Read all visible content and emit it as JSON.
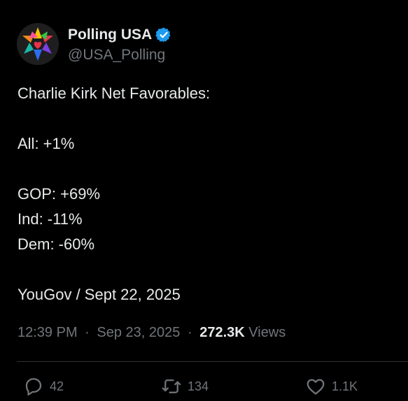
{
  "account": {
    "display_name": "Polling USA",
    "handle": "@USA_Polling",
    "verified": true,
    "verified_color": "#1d9bf0",
    "avatar_icon": "star-burst-heart-logo"
  },
  "tweet": {
    "lines": [
      "Charlie Kirk Net Favorables:",
      "",
      "All: +1%",
      "",
      "GOP: +69%",
      "Ind: -11%",
      "Dem: -60%",
      "",
      "YouGov / Sept 22, 2025"
    ]
  },
  "meta": {
    "time": "12:39 PM",
    "date": "Sep 23, 2025",
    "separator": "·",
    "views_count": "272.3K",
    "views_label": "Views"
  },
  "actions": {
    "replies": "42",
    "reposts": "134",
    "likes": "1.1K"
  },
  "colors": {
    "background": "#000000",
    "text": "#e7e9ea",
    "muted": "#71767b",
    "divider": "#2f3336"
  }
}
